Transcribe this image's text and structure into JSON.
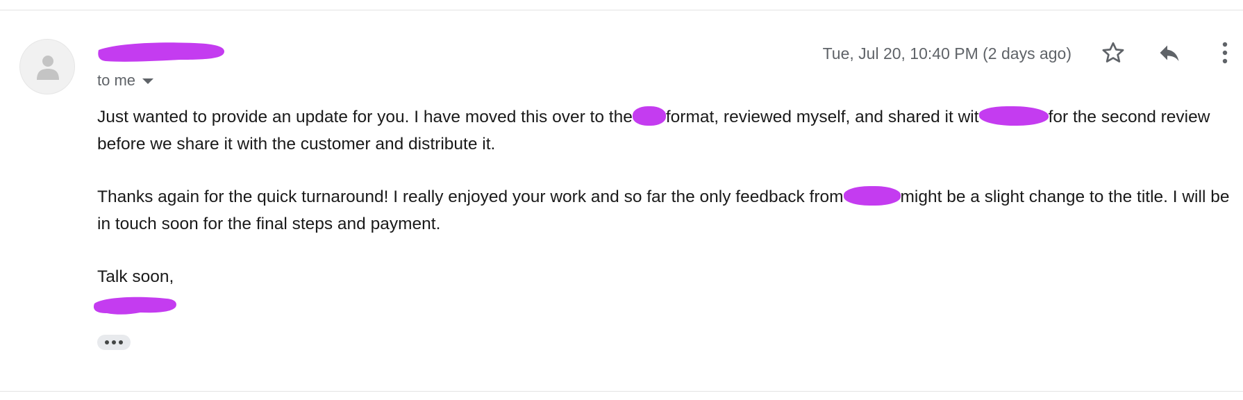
{
  "header": {
    "recipient_label": "to me",
    "date": "Tue, Jul 20, 10:40 PM (2 days ago)",
    "icons": [
      "person-avatar-icon",
      "star-icon",
      "reply-icon",
      "more-vert-icon",
      "chevron-down-icon"
    ]
  },
  "message": {
    "para1": {
      "a": "Just wanted to provide an update for you. I have moved this over to the",
      "b": "format, reviewed myself, and shared it wit",
      "c": "for the second review before we share it with the customer and distribute it."
    },
    "para2": {
      "a": "Thanks again for the quick turnaround! I really enjoyed your work and so far the only feedback from",
      "b": "might be a slight change to the title. I will be in touch soon for the final steps and payment."
    },
    "closing": "Talk soon,"
  },
  "colors": {
    "redaction": "#c43cf0",
    "secondary_text": "#5f6368"
  }
}
